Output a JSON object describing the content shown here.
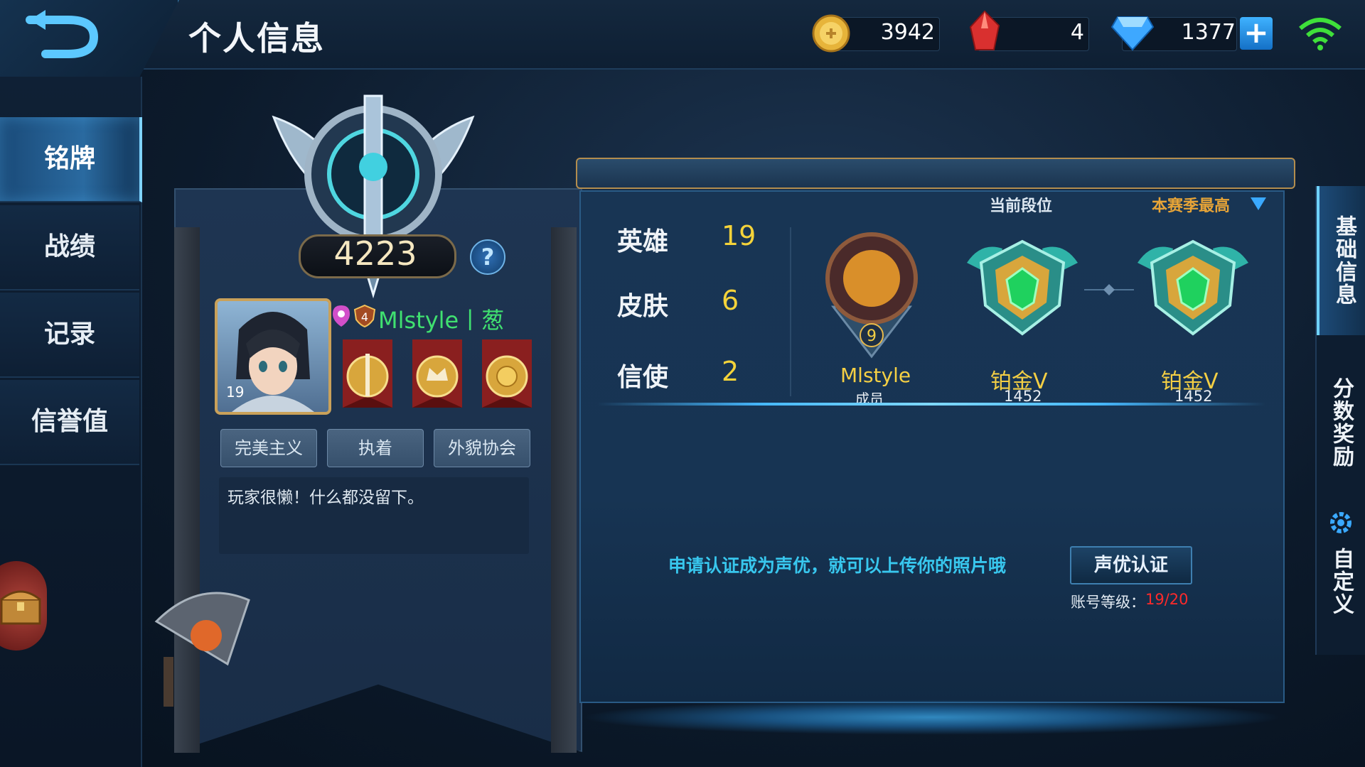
{
  "header": {
    "title": "个人信息",
    "currencies": {
      "gold": "3942",
      "crystal": "4",
      "diamond": "1377"
    }
  },
  "nav": {
    "items": [
      {
        "label": "铭牌",
        "active": true
      },
      {
        "label": "战绩",
        "active": false
      },
      {
        "label": "记录",
        "active": false
      },
      {
        "label": "信誉值",
        "active": false
      }
    ]
  },
  "profile": {
    "rank_score": "4223",
    "help": "?",
    "avatar_level": "19",
    "badge_level": "4",
    "name": "Mlstyle丨葱",
    "tags": [
      "完美主义",
      "执着",
      "外貌协会"
    ],
    "signature": "玩家很懒！什么都没留下。"
  },
  "stats": {
    "items": [
      {
        "label": "英雄",
        "value": "19"
      },
      {
        "label": "皮肤",
        "value": "6"
      },
      {
        "label": "信使",
        "value": "2"
      }
    ]
  },
  "rank": {
    "current_label": "当前段位",
    "season_best_label": "本赛季最高",
    "guild": {
      "level": "9",
      "name": "Mlstyle",
      "role": "成员"
    },
    "current": {
      "name": "铂金Ⅴ",
      "points": "1452"
    },
    "season_best": {
      "name": "铂金Ⅴ",
      "points": "1452"
    }
  },
  "voice": {
    "tip": "申请认证成为声优，就可以上传你的照片哦",
    "button": "声优认证",
    "account_level_label": "账号等级：",
    "account_level_value": "19/20"
  },
  "right_tabs": [
    "基础信息",
    "分数奖励",
    "自定义"
  ],
  "colors": {
    "accent_gold": "#f4cf44",
    "accent_cyan": "#38c7ee",
    "name_green": "#40e070",
    "warning_red": "#ff2a2a"
  }
}
